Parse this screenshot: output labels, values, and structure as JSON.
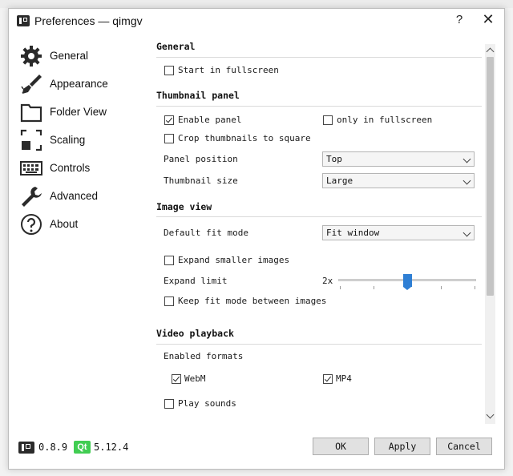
{
  "window": {
    "title": "Preferences — qimgv"
  },
  "sidebar": {
    "items": [
      {
        "label": "General",
        "icon": "gear-icon"
      },
      {
        "label": "Appearance",
        "icon": "brush-icon"
      },
      {
        "label": "Folder View",
        "icon": "folder-icon"
      },
      {
        "label": "Scaling",
        "icon": "scaling-icon"
      },
      {
        "label": "Controls",
        "icon": "keyboard-icon"
      },
      {
        "label": "Advanced",
        "icon": "wrench-icon"
      },
      {
        "label": "About",
        "icon": "help-circle-icon"
      }
    ]
  },
  "general": {
    "title": "General",
    "start_fullscreen": {
      "label": "Start in fullscreen",
      "checked": false
    }
  },
  "thumbnail_panel": {
    "title": "Thumbnail panel",
    "enable_panel": {
      "label": "Enable panel",
      "checked": true
    },
    "only_fullscreen": {
      "label": "only in fullscreen",
      "checked": false
    },
    "crop_square": {
      "label": "Crop thumbnails to square",
      "checked": false
    },
    "panel_position": {
      "label": "Panel position",
      "value": "Top"
    },
    "thumbnail_size": {
      "label": "Thumbnail size",
      "value": "Large"
    }
  },
  "image_view": {
    "title": "Image view",
    "fit_mode": {
      "label": "Default fit mode",
      "value": "Fit window"
    },
    "expand_smaller": {
      "label": "Expand smaller images",
      "checked": false
    },
    "expand_limit": {
      "label": "Expand limit",
      "value": "2x",
      "level": 0.5
    },
    "keep_fit_mode": {
      "label": "Keep fit mode between images",
      "checked": false
    }
  },
  "video_playback": {
    "title": "Video playback",
    "enabled_formats_label": "Enabled formats",
    "webm": {
      "label": "WebM",
      "checked": true
    },
    "mp4": {
      "label": "MP4",
      "checked": true
    },
    "play_sounds": {
      "label": "Play sounds",
      "checked": false
    }
  },
  "footer": {
    "app_version": "0.8.9",
    "qt_badge": "Qt",
    "qt_version": "5.12.4",
    "ok_label": "OK",
    "apply_label": "Apply",
    "cancel_label": "Cancel"
  },
  "colors": {
    "accent": "#2f7fd4",
    "qt_green": "#41cd52"
  }
}
